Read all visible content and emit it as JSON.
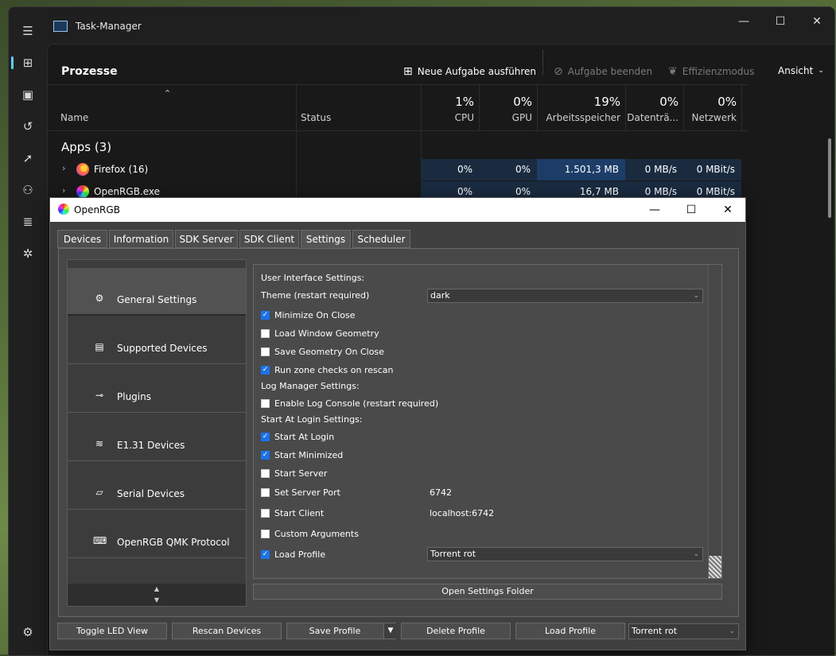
{
  "task_manager": {
    "title": "Task-Manager",
    "page_title": "Prozesse",
    "commands": {
      "new_task": "Neue Aufgabe ausführen",
      "end_task": "Aufgabe beenden",
      "efficiency": "Effizienzmodus",
      "view": "Ansicht"
    },
    "columns": {
      "name": "Name",
      "status": "Status",
      "cpu_pct": "1%",
      "cpu": "CPU",
      "gpu_pct": "0%",
      "gpu": "GPU",
      "mem_pct": "19%",
      "mem": "Arbeitsspeicher",
      "disk_pct": "0%",
      "disk": "Datenträ...",
      "net_pct": "0%",
      "net": "Netzwerk"
    },
    "group": "Apps (3)",
    "processes": [
      {
        "name": "Firefox (16)",
        "cpu": "0%",
        "gpu": "0%",
        "mem": "1.501,3 MB",
        "disk": "0 MB/s",
        "net": "0 MBit/s"
      },
      {
        "name": "OpenRGB.exe",
        "cpu": "0%",
        "gpu": "0%",
        "mem": "16,7 MB",
        "disk": "0 MB/s",
        "net": "0 MBit/s"
      }
    ],
    "icons": {
      "menu": "hamburger-icon",
      "processes": "processes-icon",
      "performance": "performance-icon",
      "history": "history-icon",
      "startup": "startup-icon",
      "users": "users-icon",
      "details": "details-icon",
      "services": "services-icon",
      "settings": "gear-icon"
    },
    "accent_color": "#60cdff"
  },
  "openrgb": {
    "title": "OpenRGB",
    "tabs": [
      "Devices",
      "Information",
      "SDK Server",
      "SDK Client",
      "Settings",
      "Scheduler"
    ],
    "active_tab": "Settings",
    "side_items": [
      {
        "label": "General Settings",
        "icon": "gear-icon"
      },
      {
        "label": "Supported Devices",
        "icon": "device-icon"
      },
      {
        "label": "Plugins",
        "icon": "plug-icon"
      },
      {
        "label": "E1.31 Devices",
        "icon": "wifi-icon"
      },
      {
        "label": "Serial Devices",
        "icon": "serial-port-icon"
      },
      {
        "label": "OpenRGB QMK Protocol",
        "icon": "keyboard-icon"
      }
    ],
    "settings": {
      "ui_section": "User Interface Settings:",
      "theme_label": "Theme (restart required)",
      "theme_value": "dark",
      "minimize_on_close": "Minimize On Close",
      "load_window_geometry": "Load Window Geometry",
      "save_geometry_on_close": "Save Geometry On Close",
      "run_zone_checks": "Run zone checks on rescan",
      "log_section": "Log Manager Settings:",
      "enable_log_console": "Enable Log Console (restart required)",
      "login_section": "Start At Login Settings:",
      "start_at_login": "Start At Login",
      "start_minimized": "Start Minimized",
      "start_server": "Start Server",
      "set_server_port": "Set Server Port",
      "server_port_value": "6742",
      "start_client": "Start Client",
      "client_value": "localhost:6742",
      "custom_arguments": "Custom Arguments",
      "load_profile": "Load Profile",
      "profile_value": "Torrent rot"
    },
    "open_settings_folder": "Open Settings Folder",
    "buttons": {
      "toggle_led_view": "Toggle LED View",
      "rescan_devices": "Rescan Devices",
      "save_profile": "Save Profile",
      "delete_profile": "Delete Profile",
      "load_profile": "Load Profile",
      "profile_select": "Torrent rot"
    },
    "check_color": "#1a73e8"
  }
}
